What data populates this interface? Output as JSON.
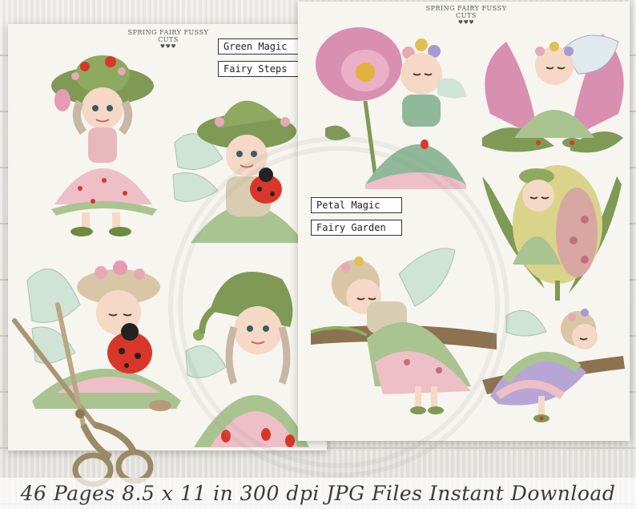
{
  "colors": {
    "paper": "#f7f5ef",
    "wood": "#e9e7e2",
    "hat_green": "#7e9a55",
    "dress_pink": "#e8b8bf",
    "ladybug_red": "#d9362a",
    "petal_pink": "#d98fb0",
    "wing": "#cfe3d6"
  },
  "left_sheet": {
    "header": "SPRING FAIRY FUSSY CUTS",
    "hearts": "♥♥♥",
    "labels": [
      "Green Magic",
      "Fairy Steps"
    ]
  },
  "right_sheet": {
    "header": "SPRING FAIRY FUSSY CUTS",
    "hearts": "♥♥♥",
    "labels": [
      "Petal Magic",
      "Fairy Garden"
    ]
  },
  "footer": {
    "text": "46 Pages 8.5 x 11 in 300 dpi JPG Files Instant Download"
  },
  "illustrations": [
    "fairy-pink-dress-green-hat",
    "fairy-hugging-ladybug",
    "fairy-sitting-with-ladybug",
    "fairy-green-knit-hat",
    "fairy-with-poppy-flower",
    "fairy-sleeping-in-tulip",
    "fairy-sleeping-in-bud",
    "fairy-sleeping-on-branch",
    "fairy-sleeping-petal-dress",
    "scissors-icon"
  ]
}
